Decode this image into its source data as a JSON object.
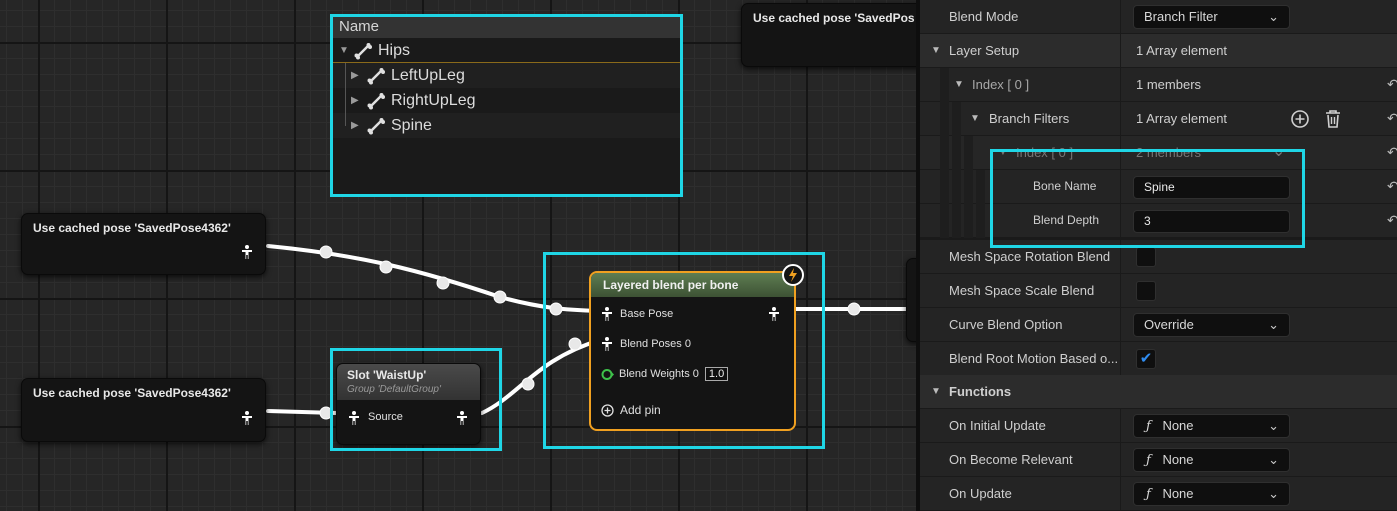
{
  "graph": {
    "cached_pose_nodes": [
      {
        "title": "Use cached pose 'SavedPose4362'"
      },
      {
        "title": "Use cached pose 'SavedPose4362'"
      },
      {
        "title": "Use cached pose 'SavedPos"
      }
    ],
    "bone_tree": {
      "header": "Name",
      "rows": [
        {
          "label": "Hips",
          "expanded": true
        },
        {
          "label": "LeftUpLeg",
          "expanded": false
        },
        {
          "label": "RightUpLeg",
          "expanded": false
        },
        {
          "label": "Spine",
          "expanded": false
        }
      ]
    },
    "slot_node": {
      "title": "Slot 'WaistUp'",
      "subtitle": "Group 'DefaultGroup'",
      "source_label": "Source"
    },
    "layered_blend_node": {
      "title": "Layered blend per bone",
      "base_pose": "Base Pose",
      "blend_poses": "Blend Poses 0",
      "blend_weights": "Blend Weights 0",
      "blend_weight_value": "1.0",
      "add_pin": "Add pin"
    },
    "highlight_color": "#1fd6e6",
    "selected_node_color": "#f0a020"
  },
  "details": {
    "blend_mode": {
      "label": "Blend Mode",
      "value": "Branch Filter"
    },
    "layer_setup": {
      "label": "Layer Setup",
      "value": "1 Array element"
    },
    "index0": {
      "label": "Index [ 0 ]",
      "value": "1 members"
    },
    "branch_filters": {
      "label": "Branch Filters",
      "value": "1 Array element"
    },
    "filter_index0": {
      "label": "Index [ 0 ]",
      "value": "2 members"
    },
    "bone_name": {
      "label": "Bone Name",
      "value": "Spine"
    },
    "blend_depth": {
      "label": "Blend Depth",
      "value": "3"
    },
    "mesh_space_rotation": {
      "label": "Mesh Space Rotation Blend",
      "checked": false
    },
    "mesh_space_scale": {
      "label": "Mesh Space Scale Blend",
      "checked": false
    },
    "curve_blend_option": {
      "label": "Curve Blend Option",
      "value": "Override"
    },
    "blend_root_motion": {
      "label": "Blend Root Motion Based o...",
      "checked": true
    },
    "functions": {
      "label": "Functions"
    },
    "on_initial_update": {
      "label": "On Initial Update",
      "value": "None"
    },
    "on_become_relevant": {
      "label": "On Become Relevant",
      "value": "None"
    },
    "on_update": {
      "label": "On Update",
      "value": "None"
    }
  }
}
